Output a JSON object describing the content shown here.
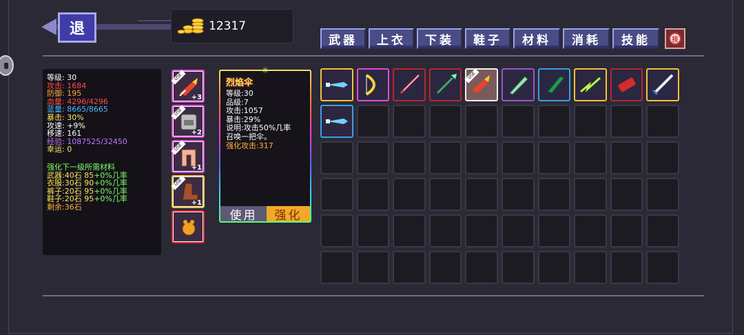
{
  "back": {
    "label": "退"
  },
  "gold": {
    "amount": "12317",
    "icon": "gold-coins-icon"
  },
  "tabs": [
    "武器",
    "上衣",
    "下装",
    "鞋子",
    "材料",
    "消耗",
    "技能"
  ],
  "skill_tab_icon": {
    "label": "技",
    "icon": "skill-icon"
  },
  "stats": {
    "level": "等级: 30",
    "attack": "攻击: 1684",
    "defense": "防御: 195",
    "hp": "血量: 4296/4296",
    "mp": "蓝量: 8665/8665",
    "crit": "暴击: 30%",
    "atk_speed": "攻速: +9%",
    "move_speed": "移速: 161",
    "exp": "经验: 1087525/32450",
    "luck": "幸运: 0",
    "upgrade_title": "强化下一级所需材料",
    "weapon_req_a": "武器:40石 85",
    "weapon_req_b": "+0%几率",
    "armor_req_a": "衣服:30石 90",
    "armor_req_b": "+0%几率",
    "pants_req_a": "裤子:20石 95",
    "pants_req_b": "+0%几率",
    "shoes_req_a": "鞋子:20石 95",
    "shoes_req_b": "+0%几率",
    "remaining": "剩余:36石"
  },
  "equipped": [
    {
      "name": "flame-umbrella-icon",
      "badge": "+3"
    },
    {
      "name": "armor-icon",
      "badge": "+2"
    },
    {
      "name": "pants-icon",
      "badge": "+1"
    },
    {
      "name": "boots-icon",
      "badge": "+1"
    },
    {
      "name": "pet-icon",
      "badge": ""
    }
  ],
  "use_tag": "USE",
  "detail": {
    "name": "烈焰伞",
    "level": "等级:30",
    "grade": "品级:7",
    "attack": "攻击:1057",
    "crit": "暴击:29%",
    "desc1": "说明:攻击50%几率",
    "desc2": "召唤一把伞。",
    "enhance_attack": "强化攻击:317",
    "use_button": "使用",
    "upgrade_button": "强化"
  },
  "inventory_row1": [
    "ice-sword-icon",
    "golden-bow-icon",
    "red-katana-icon",
    "poison-spear-icon",
    "flame-umbrella-icon",
    "green-greatsword-icon",
    "jade-blade-icon",
    "lightning-staff-icon",
    "crimson-cannon-icon",
    "silver-sword-icon"
  ],
  "inventory_row2": [
    "ice-sword-icon"
  ],
  "colors": {
    "tab_bg": "#4a4c86",
    "upgrade_btn": "#f2a927",
    "rarity_yellow": "#f2c23a",
    "rarity_pink": "#e04ad8",
    "rarity_red": "#b6272f",
    "rarity_blue": "#3a9ee6"
  }
}
